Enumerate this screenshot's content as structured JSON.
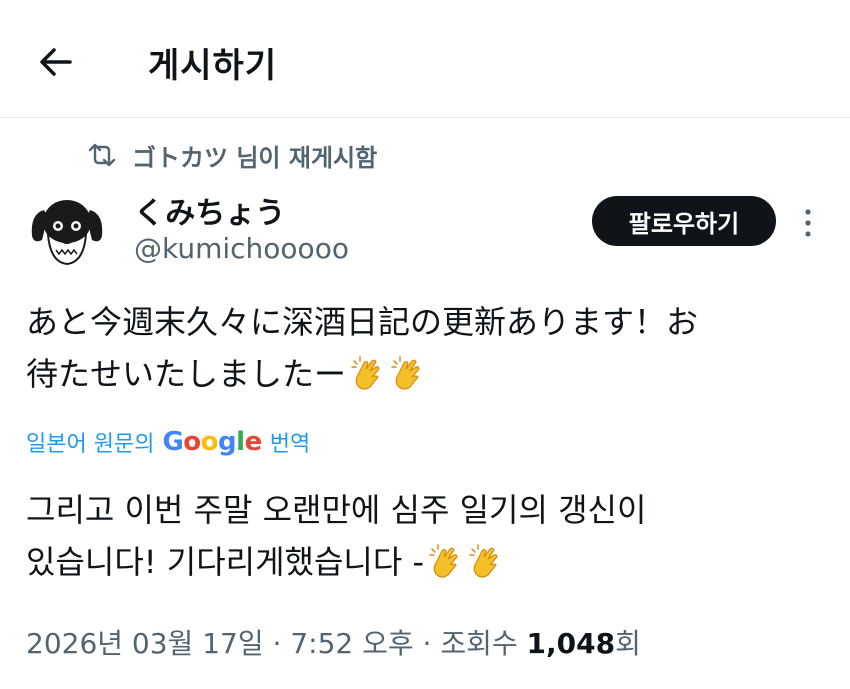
{
  "header": {
    "title": "게시하기",
    "back_icon": "arrow-left-icon"
  },
  "repost": {
    "text": "ゴトカツ 님이 재게시함",
    "icon": "repost-icon"
  },
  "author": {
    "display_name": "くみちょう",
    "handle": "@kumichooooo",
    "avatar": "dog-avatar"
  },
  "follow_label": "팔로우하기",
  "tweet": {
    "lines": [
      "あと今週末久々に深酒日記の更新あります！お",
      "待たせいたしましたー"
    ],
    "emoji": "clapping-hands-icon"
  },
  "translate": {
    "prefix": "일본어 원문의",
    "google": [
      "G",
      "o",
      "o",
      "g",
      "l",
      "e"
    ],
    "suffix": "번역"
  },
  "translation": {
    "lines": [
      "그리고 이번 주말 오랜만에 심주 일기의 갱신이",
      "있습니다! 기다리게했습니다 -"
    ]
  },
  "meta": {
    "date": "2026년 03월 17일",
    "sep1": "·",
    "time": "7:52 오후",
    "sep2": "·",
    "views_label": "조회수",
    "views_count": "1,048",
    "views_suffix": "회"
  },
  "colors": {
    "accent": "#1d9bf0",
    "text": "#0f1419",
    "muted": "#536471",
    "button": "#0f1419",
    "clap": "#f4c02a"
  }
}
